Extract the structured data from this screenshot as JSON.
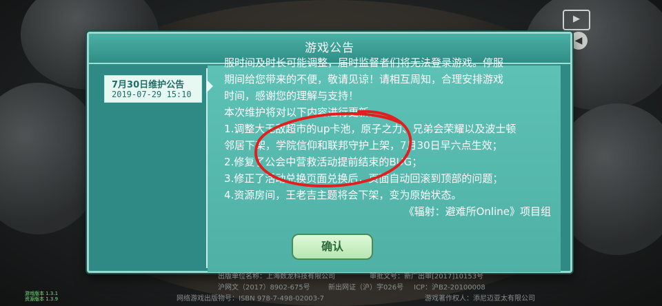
{
  "header": {
    "title": "游戏公告"
  },
  "tab": {
    "title": "7月30日维护公告",
    "date": "2019-07-29 15:10"
  },
  "notice_lines": [
    "服时间及时长可能调整，届时监督者们将无法登录游戏。停服",
    "期间给您带来的不便，敬请见谅！请相互周知，合理安排游戏",
    "时间，感谢您的理解与支持！",
    "本次维护将对以下内容进行更新。",
    "1.调整大无敌超市的up卡池，原子之力、兄弟会荣耀以及波士顿",
    "邻居下架，学院信仰和联邦守护上架，7月30日早六点生效；",
    "2.修复了公会中营救活动提前结束的BUG；",
    "3.修正了活动兑换页面兑换后，页面自动回滚到顶部的问题；",
    "4.资源房间，王老吉主题将会下架，变为原始状态。"
  ],
  "signature": "《辐射：避难所Online》项目组",
  "confirm_label": "确认",
  "footer": {
    "line1_left": "出版单位名称：上海数龙科技有限公司",
    "line1_right": "审批文号：新广出审[2017]10153号",
    "line2_a": "沪网文（2017）8902-675号",
    "line2_b": "新出网证（沪）字026号",
    "line2_c": "ICP：沪B2-20100008",
    "line3_left": "网络游戏出版物号：ISBN 978-7-498-02003-7",
    "line3_right": "游戏著作权人：添尼迈亚太有限公司"
  },
  "version": {
    "line1": "游戏版本 1.3.1",
    "line2": "资源版本 1.3.9"
  },
  "colors": {
    "panel": "#2f8a85",
    "text_panel": "#4fb1a6",
    "annotation": "#e02020"
  }
}
